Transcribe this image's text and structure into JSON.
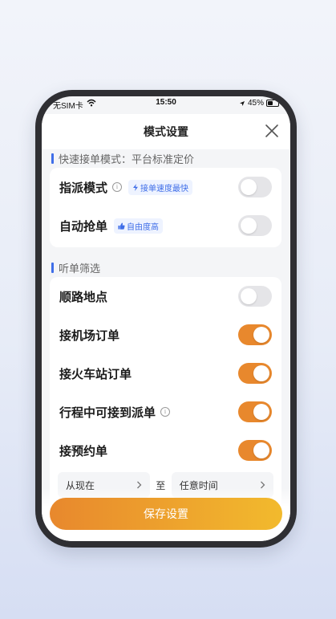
{
  "status_bar": {
    "carrier": "无SIM卡",
    "time": "15:50",
    "battery": "45%"
  },
  "nav": {
    "title": "模式设置"
  },
  "quick_mode": {
    "section_title": "快速接单模式：平台标准定价",
    "rows": [
      {
        "label": "指派模式",
        "tag": "接单速度最快",
        "tag_icon": "bolt-icon",
        "info": true,
        "enabled": false
      },
      {
        "label": "自动抢单",
        "tag": "自由度高",
        "tag_icon": "thumb-up-icon",
        "info": false,
        "enabled": false
      }
    ]
  },
  "filter": {
    "section_title": "听单筛选",
    "rows": [
      {
        "label": "顺路地点",
        "enabled": false,
        "info": false
      },
      {
        "label": "接机场订单",
        "enabled": true,
        "info": false
      },
      {
        "label": "接火车站订单",
        "enabled": true,
        "info": false
      },
      {
        "label": "行程中可接到派单",
        "enabled": true,
        "info": true
      },
      {
        "label": "接预约单",
        "enabled": true,
        "info": false
      }
    ],
    "time_range": {
      "from": "从现在",
      "separator": "至",
      "to": "任意时间"
    }
  },
  "save_button": "保存设置",
  "colors": {
    "accent_orange": "#e8882d",
    "accent_yellow": "#f2ba2d",
    "tag_blue": "#3f6ee8",
    "toggle_off": "#e5e5e8"
  }
}
